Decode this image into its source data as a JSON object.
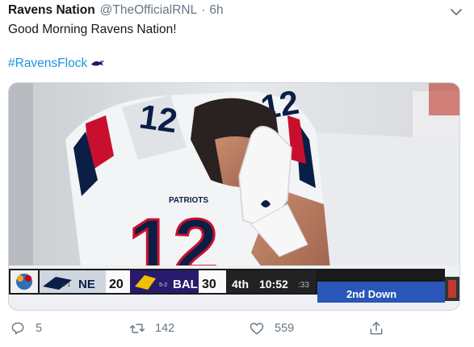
{
  "author": {
    "name": "Ravens Nation",
    "handle": "@TheOfficialRNL",
    "separator": "·",
    "time": "6h"
  },
  "tweet": {
    "line1": "Good Morning Ravens Nation!",
    "hashtag": "#RavensFlock"
  },
  "media": {
    "jersey_number": "12",
    "brand": "PATRIOTS",
    "scorebug": {
      "away_team": "NE",
      "away_score": "20",
      "home_team": "BAL",
      "home_score": "30",
      "quarter": "4th",
      "clock": "10:52",
      "play_clock": ":33",
      "down": "2nd Down",
      "small_a": "3-1",
      "small_b": "5-2"
    }
  },
  "actions": {
    "replies": "5",
    "retweets": "142",
    "likes": "559"
  },
  "icons": {
    "menu": "chevron-down-icon",
    "reply": "comment-icon",
    "retweet": "retweet-icon",
    "like": "heart-icon",
    "share": "share-icon",
    "emoji": "raven-emoji-icon"
  },
  "colors": {
    "hashtag": "#1b95e0",
    "meta": "#657786",
    "text": "#14171a",
    "jersey_navy": "#0b1e45",
    "jersey_red": "#c8102e"
  }
}
